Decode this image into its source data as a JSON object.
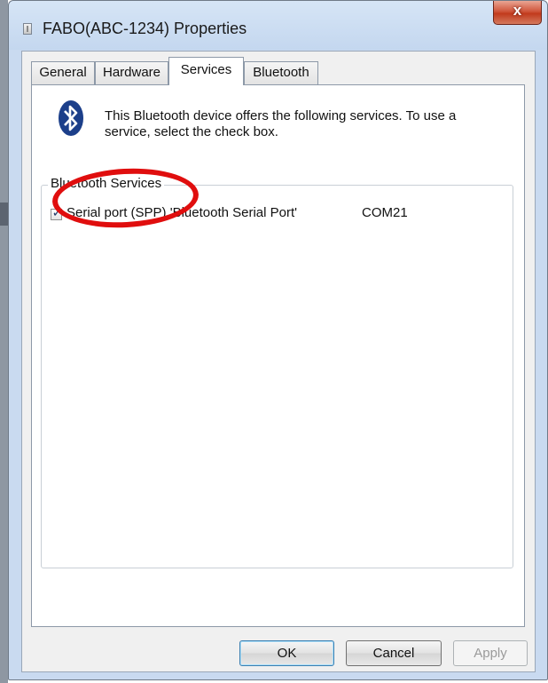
{
  "window": {
    "title": "FABO(ABC-1234) Properties",
    "close_symbol": "x"
  },
  "tabs": [
    {
      "label": "General",
      "active": false
    },
    {
      "label": "Hardware",
      "active": false
    },
    {
      "label": "Services",
      "active": true
    },
    {
      "label": "Bluetooth",
      "active": false
    }
  ],
  "services_page": {
    "icon": "bluetooth-icon",
    "description": "This Bluetooth device offers the following services. To use a service, select the check box.",
    "group_label": "Bluetooth Services",
    "services": [
      {
        "checked": true,
        "name": "Serial port (SPP) 'Bluetooth Serial Port'",
        "port": "COM21"
      }
    ]
  },
  "buttons": {
    "ok": "OK",
    "cancel": "Cancel",
    "apply": "Apply"
  },
  "colors": {
    "annotation": "#e00e0e",
    "bluetooth_blue": "#1c3f8a"
  }
}
